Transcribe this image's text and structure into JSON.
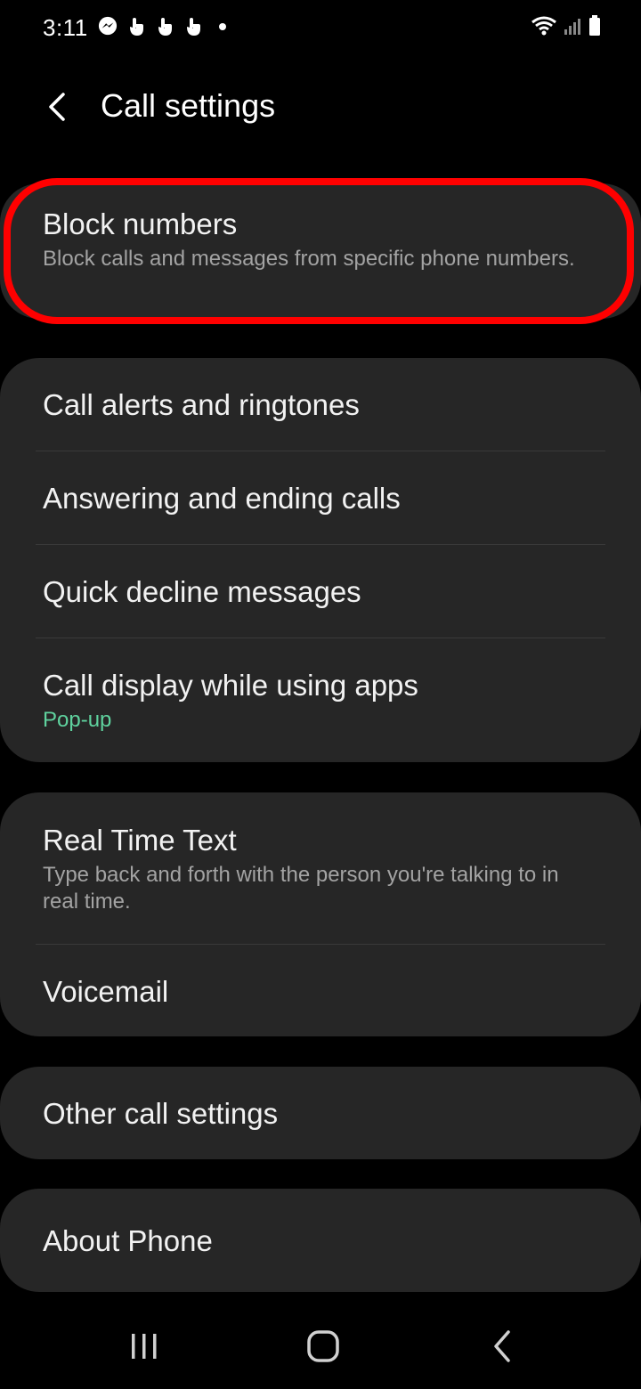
{
  "status_bar": {
    "time": "3:11",
    "left_icons": [
      "messenger-icon",
      "touch-icon",
      "touch-icon",
      "touch-icon",
      "dot-icon"
    ],
    "right_icons": [
      "wifi-icon",
      "signal-icon",
      "battery-icon"
    ]
  },
  "header": {
    "title": "Call settings",
    "back_icon": "chevron-left-icon"
  },
  "groups": [
    {
      "items": [
        {
          "title": "Block numbers",
          "subtitle": "Block calls and messages from specific phone numbers."
        }
      ]
    },
    {
      "items": [
        {
          "title": "Call alerts and ringtones"
        },
        {
          "title": "Answering and ending calls"
        },
        {
          "title": "Quick decline messages"
        },
        {
          "title": "Call display while using apps",
          "value": "Pop-up"
        }
      ]
    },
    {
      "items": [
        {
          "title": "Real Time Text",
          "subtitle": "Type back and forth with the person you're talking to in real time."
        },
        {
          "title": "Voicemail"
        }
      ]
    },
    {
      "items": [
        {
          "title": "Other call settings"
        }
      ]
    },
    {
      "items": [
        {
          "title": "About Phone"
        }
      ]
    }
  ],
  "nav_bar": {
    "buttons": [
      "recents-icon",
      "home-icon",
      "back-icon"
    ]
  },
  "colors": {
    "background": "#000000",
    "card": "#262626",
    "accent": "#5fd29e",
    "highlight": "#ff0000"
  }
}
